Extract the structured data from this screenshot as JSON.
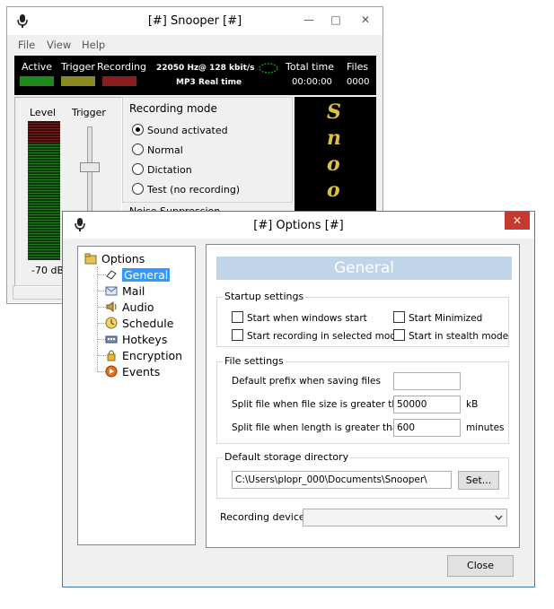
{
  "main_window": {
    "title": "[#] Snooper [#]",
    "menu": [
      "File",
      "View",
      "Help"
    ],
    "status": {
      "active_label": "Active",
      "trigger_label": "Trigger",
      "recording_label": "Recording",
      "sample_rate": "22050 Hz",
      "bitrate": "@ 128 kbit/s",
      "format": "MP3 Real time",
      "total_time_label": "Total time",
      "total_time_value": "00:00:00",
      "files_label": "Files",
      "files_value": "0000",
      "led_colors": {
        "active": "#1e8a1e",
        "trigger": "#8a8a1e",
        "recording": "#8a1e1e"
      }
    },
    "meter": {
      "level_label": "Level",
      "trigger_label": "Trigger",
      "db_value": "-70 dB"
    },
    "recording_mode": {
      "title": "Recording mode",
      "options": [
        "Sound activated",
        "Normal",
        "Dictation",
        "Test (no recording)"
      ],
      "selected_index": 0
    },
    "noise_suppression_label": "Noise Suppression",
    "logo_letters": [
      "S",
      "n",
      "o",
      "o"
    ]
  },
  "options_dialog": {
    "title": "[#] Options [#]",
    "tree": {
      "root": "Options",
      "items": [
        "General",
        "Mail",
        "Audio",
        "Schedule",
        "Hotkeys",
        "Encryption",
        "Events"
      ],
      "selected_index": 0
    },
    "page_title": "General",
    "startup": {
      "title": "Startup settings",
      "start_when_windows_start": "Start when windows start",
      "start_minimized": "Start Minimized",
      "start_recording_in_selected_mode": "Start recording in selected mode",
      "start_in_stealth_mode": "Start in stealth mode"
    },
    "file_settings": {
      "title": "File settings",
      "default_prefix_label": "Default prefix when saving files",
      "default_prefix_value": "",
      "split_size_label": "Split file when file size is greater than",
      "split_size_value": "50000",
      "split_size_unit": "kB",
      "split_length_label": "Split file when length is greater than",
      "split_length_value": "600",
      "split_length_unit": "minutes"
    },
    "storage": {
      "title": "Default storage directory",
      "path": "C:\\Users\\plopr_000\\Documents\\Snooper\\",
      "set_button": "Set..."
    },
    "recording_device_label": "Recording device",
    "recording_device_value": "",
    "close_button": "Close",
    "header_color": "#c0d4ea",
    "close_titlebar_color": "#c7392f"
  }
}
